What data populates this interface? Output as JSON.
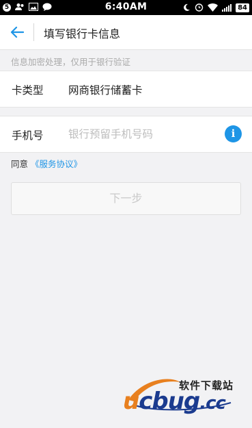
{
  "status_bar": {
    "notification_count": "5",
    "time": "6:40AM",
    "battery": "84"
  },
  "header": {
    "back_icon": "arrow-left-icon",
    "title": "填写银行卡信息"
  },
  "hint": "信息加密处理，仅用于银行验证",
  "card_row": {
    "label": "卡类型",
    "value": "网商银行储蓄卡"
  },
  "phone_row": {
    "label": "手机号",
    "placeholder": "银行预留手机号码",
    "value": "",
    "info_icon": "i"
  },
  "agreement": {
    "prefix": "同意",
    "link": "《服务协议》"
  },
  "next_button": "下一步",
  "watermark": {
    "tagline": "软件下载站",
    "logo_u": "u",
    "logo_rest": "cbug",
    "logo_cc": ".cc"
  },
  "colors": {
    "accent": "#1e95e6",
    "background": "#f2f2f4"
  }
}
